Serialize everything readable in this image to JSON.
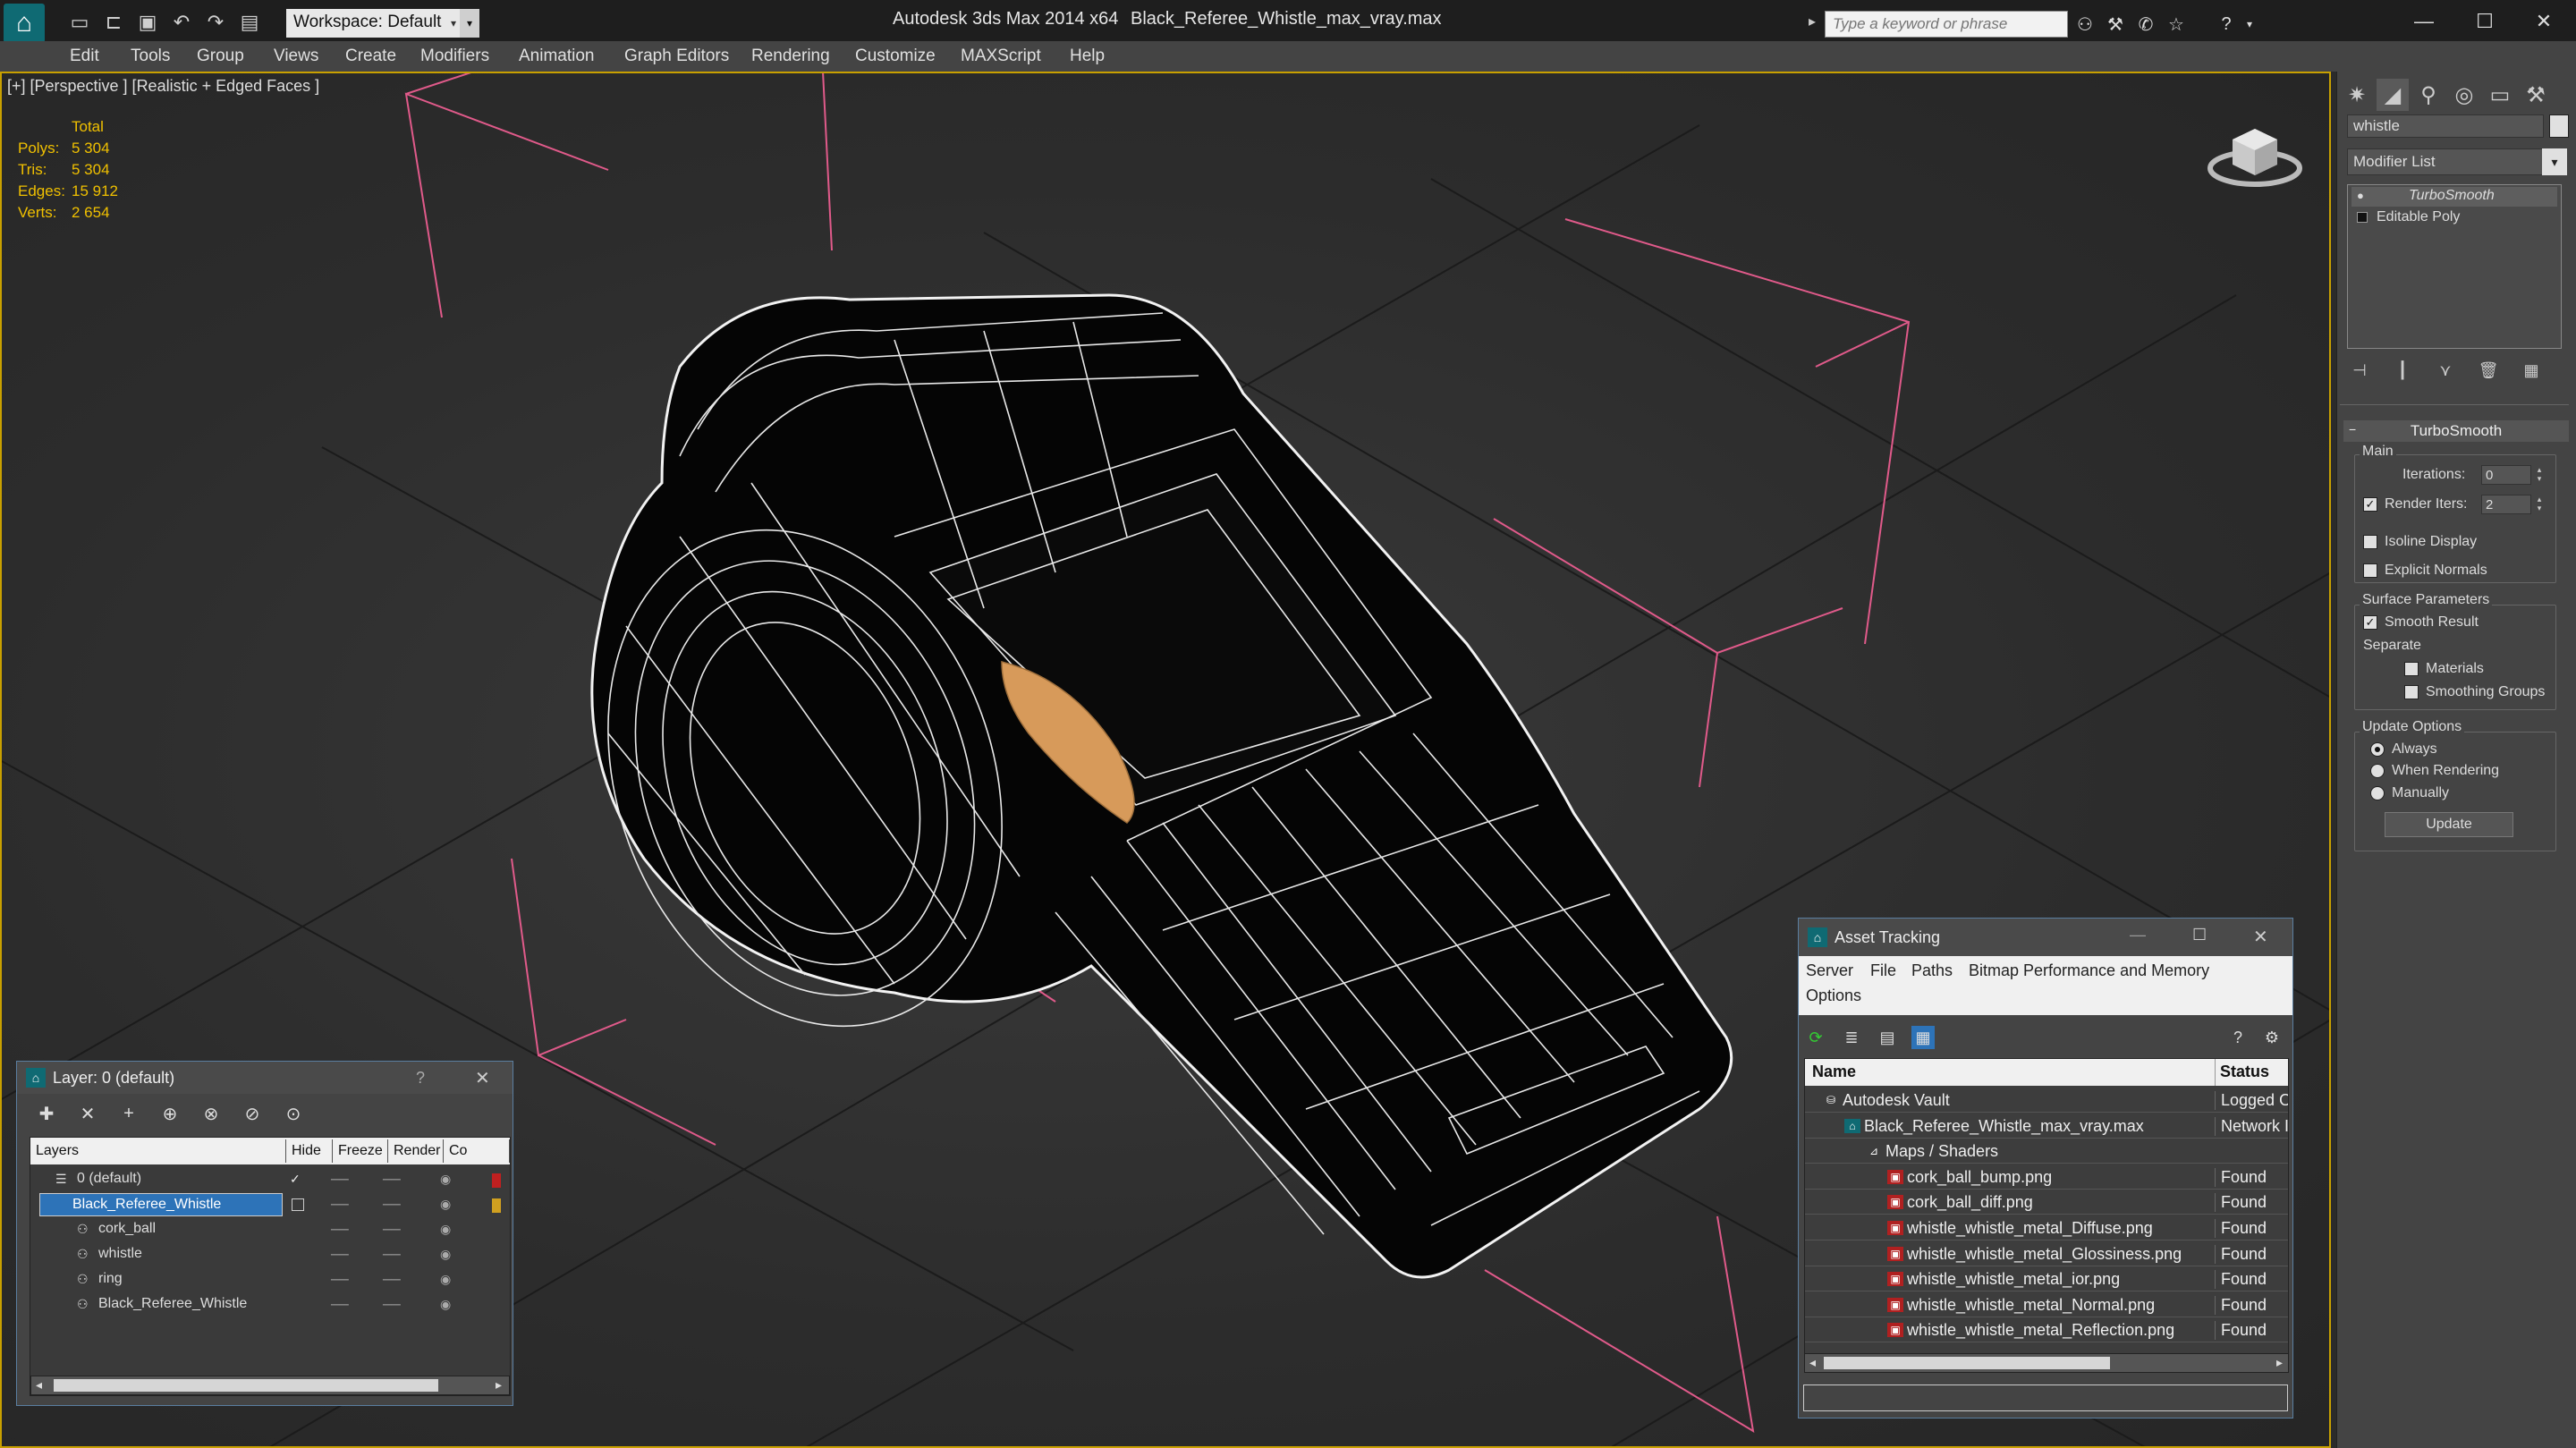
{
  "titlebar": {
    "app_title": "Autodesk 3ds Max  2014 x64",
    "file_title": "Black_Referee_Whistle_max_vray.max",
    "workspace": "Workspace: Default",
    "search_placeholder": "Type a keyword or phrase"
  },
  "menu": [
    "Edit",
    "Tools",
    "Group",
    "Views",
    "Create",
    "Modifiers",
    "Animation",
    "Graph Editors",
    "Rendering",
    "Customize",
    "MAXScript",
    "Help"
  ],
  "viewport": {
    "label": "[+] [Perspective ] [Realistic + Edged Faces ]",
    "stats": {
      "total": "Total",
      "rows": [
        {
          "label": "Polys:",
          "value": "5 304"
        },
        {
          "label": "Tris:",
          "value": "5 304"
        },
        {
          "label": "Edges:",
          "value": "15 912"
        },
        {
          "label": "Verts:",
          "value": "2 654"
        }
      ]
    }
  },
  "command_panel": {
    "object_name": "whistle",
    "modifier_list": "Modifier List",
    "stack": [
      "TurboSmooth",
      "Editable Poly"
    ],
    "rollout": "TurboSmooth",
    "main_group": "Main",
    "iterations_label": "Iterations:",
    "iterations_value": "0",
    "render_iters_label": "Render Iters:",
    "render_iters_value": "2",
    "isoline": "Isoline Display",
    "explicit_normals": "Explicit Normals",
    "surface_group": "Surface Parameters",
    "smooth_result": "Smooth Result",
    "separate": "Separate",
    "materials": "Materials",
    "smoothing_groups": "Smoothing Groups",
    "update_group": "Update Options",
    "always": "Always",
    "when_rendering": "When Rendering",
    "manually": "Manually",
    "update_button": "Update"
  },
  "layer_dialog": {
    "title": "Layer: 0 (default)",
    "help": "?",
    "columns": [
      "Layers",
      "Hide",
      "Freeze",
      "Render",
      "Co"
    ],
    "rows": [
      {
        "name": "0 (default)",
        "indent": 0,
        "selected": false
      },
      {
        "name": "Black_Referee_Whistle",
        "indent": 0,
        "selected": true
      },
      {
        "name": "cork_ball",
        "indent": 1,
        "selected": false
      },
      {
        "name": "whistle",
        "indent": 1,
        "selected": false
      },
      {
        "name": "ring",
        "indent": 1,
        "selected": false
      },
      {
        "name": "Black_Referee_Whistle",
        "indent": 1,
        "selected": false
      }
    ]
  },
  "asset_dialog": {
    "title": "Asset Tracking",
    "menu": [
      "Server",
      "File",
      "Paths",
      "Bitmap Performance and Memory",
      "Options"
    ],
    "columns": [
      "Name",
      "Status"
    ],
    "rows": [
      {
        "name": "Autodesk Vault",
        "status": "Logged O",
        "indent": 1,
        "icon": "vault-icon"
      },
      {
        "name": "Black_Referee_Whistle_max_vray.max",
        "status": "Network I",
        "indent": 2,
        "icon": "max-file-icon"
      },
      {
        "name": "Maps / Shaders",
        "status": "",
        "indent": 3,
        "icon": "maps-icon"
      },
      {
        "name": "cork_ball_bump.png",
        "status": "Found",
        "indent": 4,
        "icon": "png-icon"
      },
      {
        "name": "cork_ball_diff.png",
        "status": "Found",
        "indent": 4,
        "icon": "png-icon"
      },
      {
        "name": "whistle_whistle_metal_Diffuse.png",
        "status": "Found",
        "indent": 4,
        "icon": "png-icon"
      },
      {
        "name": "whistle_whistle_metal_Glossiness.png",
        "status": "Found",
        "indent": 4,
        "icon": "png-icon"
      },
      {
        "name": "whistle_whistle_metal_ior.png",
        "status": "Found",
        "indent": 4,
        "icon": "png-icon"
      },
      {
        "name": "whistle_whistle_metal_Normal.png",
        "status": "Found",
        "indent": 4,
        "icon": "png-icon"
      },
      {
        "name": "whistle_whistle_metal_Reflection.png",
        "status": "Found",
        "indent": 4,
        "icon": "png-icon"
      }
    ]
  },
  "colors": {
    "accent": "#2d73b8",
    "stat_text": "#f0c000",
    "bbox_lines": "#e05a8a",
    "cork": "#d79a5a"
  }
}
